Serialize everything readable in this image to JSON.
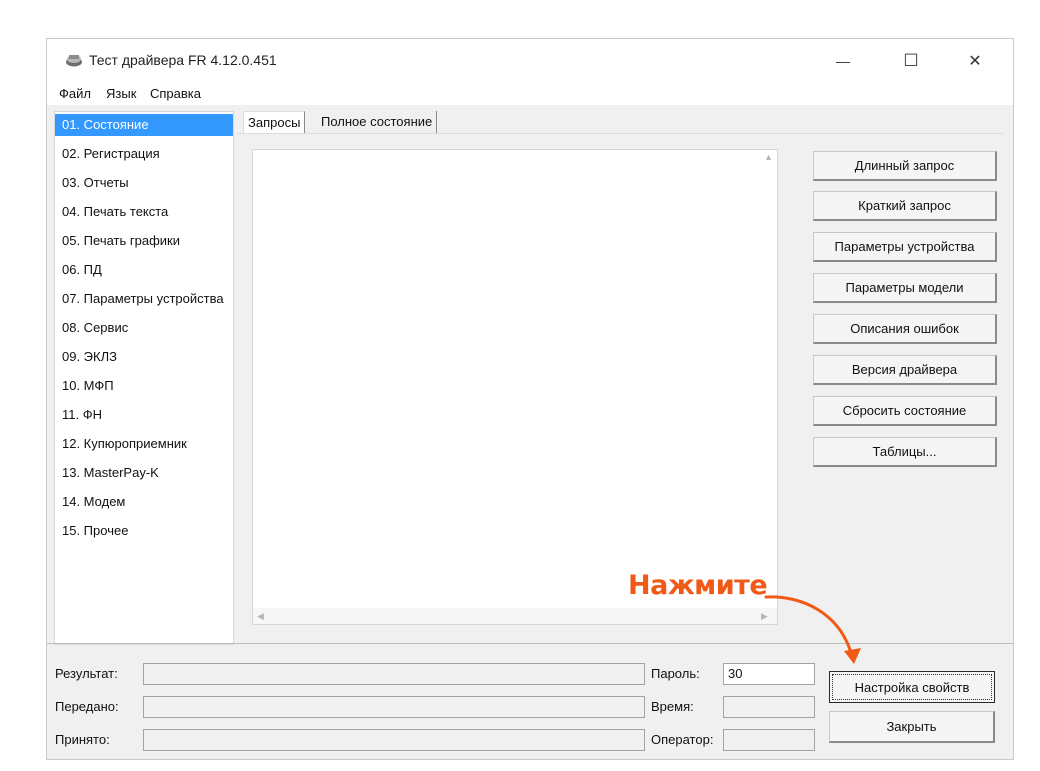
{
  "window": {
    "title": "Тест драйвера FR 4.12.0.451",
    "controls": {
      "minimize": "—",
      "maximize": "☐",
      "close": "✕"
    }
  },
  "menu": [
    "Файл",
    "Язык",
    "Справка"
  ],
  "nav": {
    "selected_index": 0,
    "items": [
      "01. Состояние",
      "02. Регистрация",
      "03. Отчеты",
      "04. Печать текста",
      "05. Печать графики",
      "06. ПД",
      "07. Параметры устройства",
      "08. Сервис",
      "09. ЭКЛЗ",
      "10. МФП",
      "11. ФН",
      "12. Купюроприемник",
      "13. MasterPay-K",
      "14. Модем",
      "15. Прочее"
    ]
  },
  "tabs": [
    "Запросы",
    "Полное состояние"
  ],
  "buttons": [
    "Длинный запрос",
    "Краткий запрос",
    "Параметры устройства",
    "Параметры модели",
    "Описания ошибок",
    "Версия драйвера",
    "Сбросить состояние",
    "Таблицы..."
  ],
  "status": {
    "result_label": "Результат:",
    "sent_label": "Передано:",
    "received_label": "Принято:",
    "password_label": "Пароль:",
    "password_value": "30",
    "time_label": "Время:",
    "operator_label": "Оператор:"
  },
  "bottom_buttons": {
    "settings": "Настройка свойств",
    "close": "Закрыть"
  },
  "annotation": {
    "text": "Нажмите",
    "color": "#f05a16"
  },
  "colors": {
    "selection": "#3399ff"
  }
}
